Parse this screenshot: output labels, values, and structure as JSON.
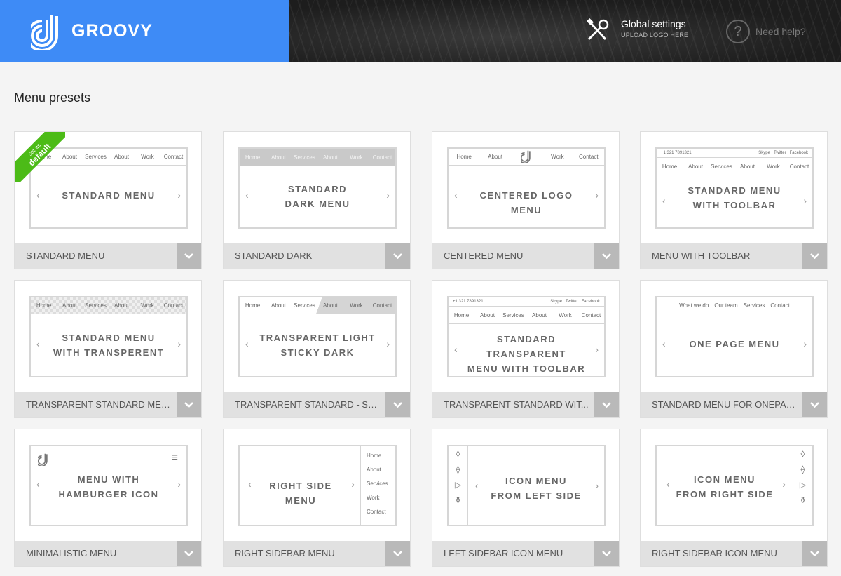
{
  "header": {
    "brand": "GROOVY",
    "global_settings": {
      "title": "Global settings",
      "subtitle": "UPLOAD LOGO HERE",
      "icon": "tools-icon"
    },
    "help": {
      "label": "Need help?",
      "icon": "question-icon"
    }
  },
  "page": {
    "title": "Menu presets"
  },
  "ribbon": {
    "line1": "set as",
    "line2": "default"
  },
  "cards": [
    {
      "name": "STANDARD MENU",
      "preview": {
        "nav": [
          "Home",
          "About",
          "Services",
          "About",
          "Work",
          "Contact"
        ],
        "line1": "STANDARD MENU",
        "line2": ""
      }
    },
    {
      "name": "STANDARD DARK",
      "preview": {
        "nav": [
          "Home",
          "About",
          "Services",
          "About",
          "Work",
          "Contact"
        ],
        "line1": "STANDARD",
        "line2": "DARK MENU"
      }
    },
    {
      "name": "CENTERED MENU",
      "preview": {
        "nav_left": [
          "Home",
          "About"
        ],
        "nav_right": [
          "Work",
          "Contact"
        ],
        "line1": "CENTERED LOGO MENU",
        "line2": ""
      }
    },
    {
      "name": "MENU WITH TOOLBAR",
      "preview": {
        "toolbar_phone": "+1 321 7891321",
        "toolbar_links": [
          "Skype",
          "Twitter",
          "Facebook"
        ],
        "nav": [
          "Home",
          "About",
          "Services",
          "About",
          "Work",
          "Contact"
        ],
        "line1": "STANDARD MENU",
        "line2": "WITH TOOLBAR"
      }
    },
    {
      "name": "TRANSPARENT STANDARD MENU",
      "preview": {
        "nav": [
          "Home",
          "About",
          "Services",
          "About",
          "Work",
          "Contact"
        ],
        "line1": "STANDARD MENU",
        "line2": "WITH TRANSPERENT"
      }
    },
    {
      "name": "TRANSPARENT STANDARD - STI...",
      "preview": {
        "nav": [
          "Home",
          "About",
          "Services",
          "About",
          "Work",
          "Contact"
        ],
        "line1": "TRANSPARENT LIGHT",
        "line2": "STICKY DARK"
      }
    },
    {
      "name": "TRANSPARENT STANDARD WIT...",
      "preview": {
        "toolbar_phone": "+1 321 7891321",
        "toolbar_links": [
          "Skype",
          "Twitter",
          "Facebook"
        ],
        "nav": [
          "Home",
          "About",
          "Services",
          "About",
          "Work",
          "Contact"
        ],
        "line1": "STANDARD TRANSPARENT",
        "line2": "MENU WITH TOOLBAR"
      }
    },
    {
      "name": "STANDARD MENU FOR ONEPAG...",
      "preview": {
        "nav": [
          "What we do",
          "Our team",
          "Services",
          "Contact"
        ],
        "line1": "ONE PAGE MENU",
        "line2": ""
      }
    },
    {
      "name": "MINIMALISTIC MENU",
      "preview": {
        "line1": "MENU WITH",
        "line2": "HAMBURGER ICON"
      }
    },
    {
      "name": "RIGHT SIDEBAR MENU",
      "preview": {
        "nav": [
          "Home",
          "About",
          "Services",
          "Work",
          "Contact"
        ],
        "line1": "RIGHT SIDE MENU",
        "line2": ""
      }
    },
    {
      "name": "LEFT SIDEBAR ICON MENU",
      "preview": {
        "line1": "ICON MENU",
        "line2": "FROM LEFT SIDE"
      }
    },
    {
      "name": "RIGHT SIDEBAR ICON MENU",
      "preview": {
        "line1": "ICON MENU",
        "line2": "FROM RIGHT SIDE"
      }
    }
  ],
  "icons": {
    "chevron_left": "‹",
    "chevron_right": "›",
    "sidebar_icons": [
      "drop-icon",
      "compass-icon",
      "play-icon",
      "bag-icon"
    ],
    "sidebar_glyphs": [
      "◊",
      "⟠",
      "▷",
      "⚱"
    ],
    "hamburger": "≡"
  },
  "colors": {
    "brand_blue": "#3e8bf6",
    "ribbon_green": "#4cbb17",
    "footer_gray": "#e1e1e1",
    "dropdown_gray": "#b9b9b9"
  }
}
